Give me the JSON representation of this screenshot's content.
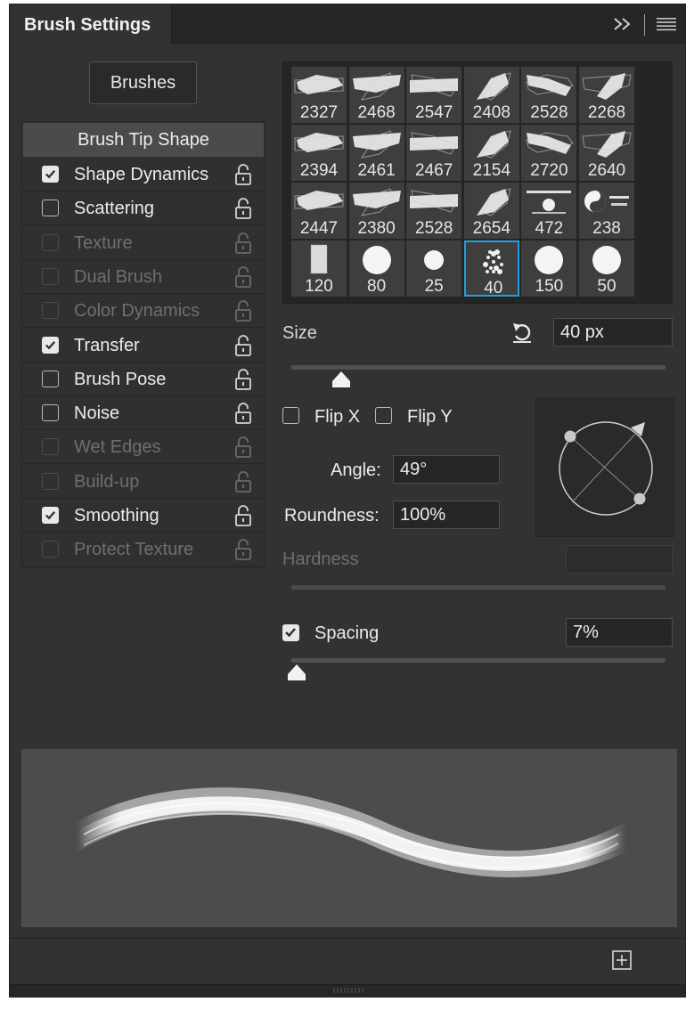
{
  "panel": {
    "title": "Brush Settings",
    "collapse_icon": "double-chevron-right-icon",
    "menu_icon": "hamburger-menu-icon"
  },
  "brushes_button": "Brushes",
  "tip_shape_label": "Brush Tip Shape",
  "options": [
    {
      "label": "Shape Dynamics",
      "checked": true,
      "enabled": true
    },
    {
      "label": "Scattering",
      "checked": false,
      "enabled": true
    },
    {
      "label": "Texture",
      "checked": false,
      "enabled": false
    },
    {
      "label": "Dual Brush",
      "checked": false,
      "enabled": false
    },
    {
      "label": "Color Dynamics",
      "checked": false,
      "enabled": false
    },
    {
      "label": "Transfer",
      "checked": true,
      "enabled": true
    },
    {
      "label": "Brush Pose",
      "checked": false,
      "enabled": true
    },
    {
      "label": "Noise",
      "checked": false,
      "enabled": true
    },
    {
      "label": "Wet Edges",
      "checked": false,
      "enabled": false
    },
    {
      "label": "Build-up",
      "checked": false,
      "enabled": false
    },
    {
      "label": "Smoothing",
      "checked": true,
      "enabled": true
    },
    {
      "label": "Protect Texture",
      "checked": false,
      "enabled": false
    }
  ],
  "brush_presets": [
    {
      "size": "2327",
      "kind": "texture"
    },
    {
      "size": "2468",
      "kind": "texture"
    },
    {
      "size": "2547",
      "kind": "texture"
    },
    {
      "size": "2408",
      "kind": "texture"
    },
    {
      "size": "2528",
      "kind": "texture"
    },
    {
      "size": "2268",
      "kind": "texture"
    },
    {
      "size": "2394",
      "kind": "texture"
    },
    {
      "size": "2461",
      "kind": "texture"
    },
    {
      "size": "2467",
      "kind": "texture"
    },
    {
      "size": "2154",
      "kind": "texture"
    },
    {
      "size": "2720",
      "kind": "texture"
    },
    {
      "size": "2640",
      "kind": "texture"
    },
    {
      "size": "2447",
      "kind": "texture"
    },
    {
      "size": "2380",
      "kind": "texture"
    },
    {
      "size": "2528",
      "kind": "texture"
    },
    {
      "size": "2654",
      "kind": "texture"
    },
    {
      "size": "472",
      "kind": "logo"
    },
    {
      "size": "238",
      "kind": "logo"
    },
    {
      "size": "120",
      "kind": "bar"
    },
    {
      "size": "80",
      "kind": "round"
    },
    {
      "size": "25",
      "kind": "round-small"
    },
    {
      "size": "40",
      "kind": "splatter",
      "selected": true
    },
    {
      "size": "150",
      "kind": "round"
    },
    {
      "size": "50",
      "kind": "round"
    }
  ],
  "size": {
    "label": "Size",
    "value": "40 px",
    "reset_icon": "reset-arrow-icon",
    "slider": 0.13
  },
  "flip_x": {
    "label": "Flip X",
    "checked": false
  },
  "flip_y": {
    "label": "Flip Y",
    "checked": false
  },
  "angle": {
    "label": "Angle:",
    "value": "49°"
  },
  "roundness": {
    "label": "Roundness:",
    "value": "100%"
  },
  "hardness": {
    "label": "Hardness",
    "value": ""
  },
  "spacing": {
    "label": "Spacing",
    "checked": true,
    "value": "7%",
    "slider": 0.01
  },
  "footer": {
    "new_icon": "new-brush-icon"
  },
  "colors": {
    "accent": "#21a0e1",
    "panel": "#323232",
    "field": "#262626"
  }
}
